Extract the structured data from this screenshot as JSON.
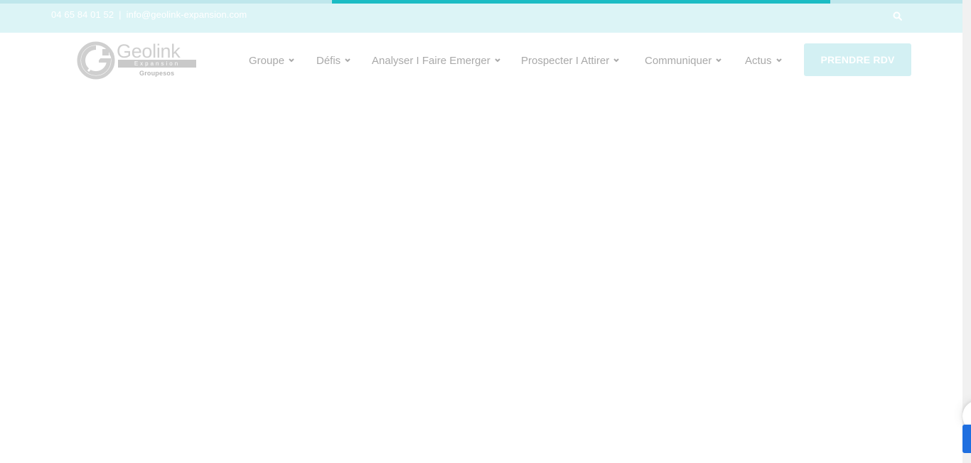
{
  "topbar": {
    "phone": "04 65 84 01 52",
    "separator": "|",
    "email": "info@geolink-expansion.com",
    "search_icon": "search-icon",
    "load_progress": 0.513
  },
  "logo": {
    "name": "Geolink",
    "band": "Expansion",
    "sub": "Groupesos"
  },
  "nav": {
    "items": [
      {
        "label": "Groupe"
      },
      {
        "label": "Défis"
      },
      {
        "label": "Analyser I Faire Emerger"
      },
      {
        "label": "Prospecter I Attirer"
      },
      {
        "label": "Communiquer"
      },
      {
        "label": "Actus"
      }
    ],
    "cta_label": "PRENDRE RDV"
  },
  "colors": {
    "topbar_bg": "#dcf4f6",
    "progress": "#1bbcc4",
    "nav_text": "#a9a9a9",
    "cta_bg": "#d3f0f3",
    "widget_blue": "#1f6fe0"
  }
}
